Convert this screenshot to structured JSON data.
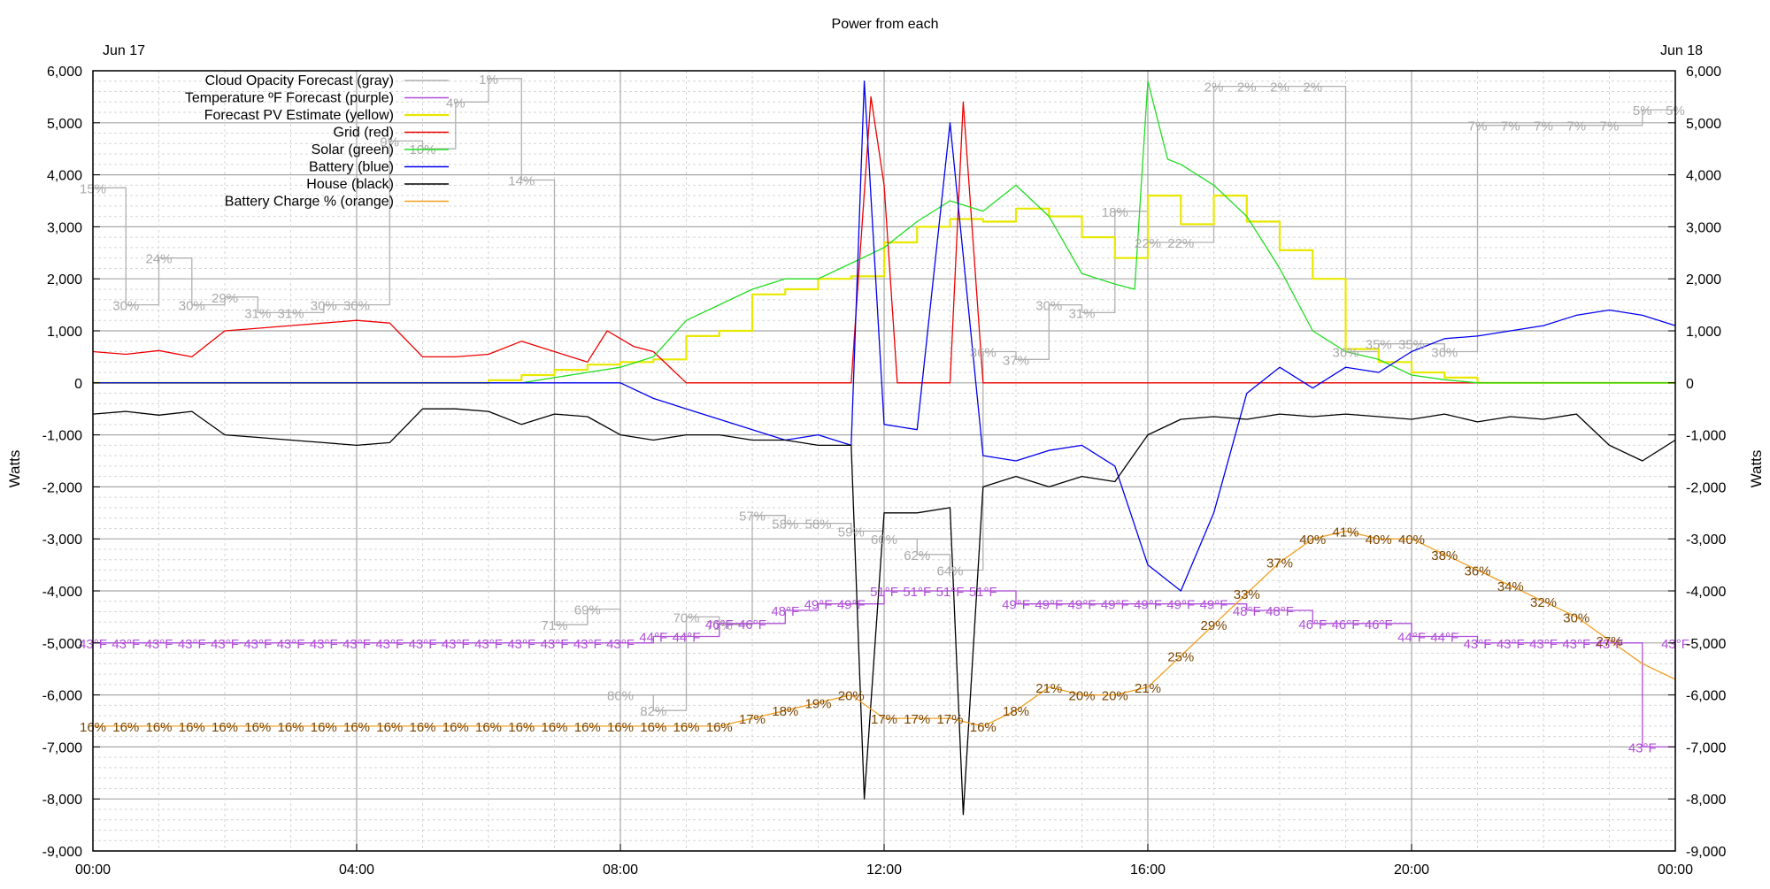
{
  "chart_data": {
    "type": "line",
    "title": "Power from each",
    "ylabel_left": "Watts",
    "ylabel_right": "Watts",
    "date_start": "Jun 17",
    "date_end": "Jun 18",
    "ylim": [
      -9000,
      6000
    ],
    "xlim_hours": [
      0,
      24
    ],
    "grid": true,
    "legend_placement": "top-left",
    "y_ticks": [
      "6,000",
      "5,000",
      "4,000",
      "3,000",
      "2,000",
      "1,000",
      "0",
      "-1,000",
      "-2,000",
      "-3,000",
      "-4,000",
      "-5,000",
      "-6,000",
      "-7,000",
      "-8,000",
      "-9,000"
    ],
    "x_ticks": [
      "00:00",
      "04:00",
      "08:00",
      "12:00",
      "16:00",
      "20:00",
      "00:00"
    ],
    "series": [
      {
        "name": "Cloud Opacity Forecast (gray)",
        "color": "#b0b0b0",
        "x": [
          0,
          0.5,
          1,
          1.5,
          2,
          2.5,
          3,
          3.5,
          4,
          4.5,
          5,
          5.5,
          6,
          6.5,
          7,
          7.5,
          8,
          8.5,
          9,
          9.5,
          10,
          10.5,
          11,
          11.5,
          12,
          12.5,
          13,
          13.5,
          14,
          14.5,
          15,
          15.5,
          16,
          16.5,
          17,
          17.5,
          18,
          18.5,
          19,
          19.5,
          20,
          20.5,
          21,
          21.5,
          22,
          22.5,
          23,
          23.5,
          24
        ],
        "y": [
          15,
          30,
          24,
          30,
          29,
          31,
          31,
          30,
          30,
          9,
          10,
          4,
          1,
          14,
          71,
          69,
          80,
          82,
          70,
          71,
          57,
          58,
          58,
          59,
          60,
          62,
          64,
          36,
          37,
          30,
          31,
          18,
          22,
          22,
          2,
          2,
          2,
          2,
          36,
          35,
          35,
          36,
          7,
          7,
          7,
          7,
          7,
          5,
          5
        ],
        "labels": [
          "15%",
          "30%",
          "24%",
          "30%",
          "29%",
          "31%",
          "31%",
          "30%",
          "30%",
          "9%",
          "10%",
          "4%",
          "1%",
          "14%",
          "71%",
          "69%",
          "80%",
          "82%",
          "70%",
          "71%",
          "57%",
          "58%",
          "58%",
          "59%",
          "60%",
          "62%",
          "64%",
          "36%",
          "37%",
          "30%",
          "31%",
          "18%",
          "22%",
          "22%",
          "2%",
          "2%",
          "2%",
          "2%",
          "36%",
          "35%",
          "35%",
          "36%",
          "7%",
          "7%",
          "7%",
          "7%",
          "7%",
          "5%",
          "5%"
        ]
      },
      {
        "name": "Temperature ºF Forecast (purple)",
        "color": "#b04fd8",
        "x": [
          0,
          0.5,
          1,
          1.5,
          2,
          2.5,
          3,
          3.5,
          4,
          4.5,
          5,
          5.5,
          6,
          6.5,
          7,
          7.5,
          8,
          8.5,
          9,
          9.5,
          10,
          10.5,
          11,
          11.5,
          12,
          12.5,
          13,
          13.5,
          14,
          14.5,
          15,
          15.5,
          16,
          16.5,
          17,
          17.5,
          18,
          18.5,
          19,
          19.5,
          20,
          20.5,
          21,
          21.5,
          22,
          22.5,
          23,
          23.5,
          24
        ],
        "y": [
          43,
          43,
          43,
          43,
          43,
          43,
          43,
          43,
          43,
          43,
          43,
          43,
          43,
          43,
          43,
          43,
          43,
          44,
          44,
          46,
          46,
          48,
          49,
          49,
          51,
          51,
          51,
          51,
          49,
          49,
          49,
          49,
          49,
          49,
          49,
          48,
          48,
          46,
          46,
          46,
          44,
          44,
          43,
          43,
          43,
          43,
          43,
          27,
          43
        ],
        "labels": [
          "43°F",
          "43°F",
          "43°F",
          "43°F",
          "43°F",
          "43°F",
          "43°F",
          "43°F",
          "43°F",
          "43°F",
          "43°F",
          "43°F",
          "43°F",
          "43°F",
          "43°F",
          "43°F",
          "43°F",
          "44°F",
          "44°F",
          "46°F",
          "46°F",
          "48°F",
          "49°F",
          "49°F",
          "51°F",
          "51°F",
          "51°F",
          "51°F",
          "49°F",
          "49°F",
          "49°F",
          "49°F",
          "49°F",
          "49°F",
          "49°F",
          "48°F",
          "48°F",
          "46°F",
          "46°F",
          "46°F",
          "44°F",
          "44°F",
          "43°F",
          "43°F",
          "43°F",
          "43°F",
          "43°F",
          "43°F",
          "43°F"
        ]
      },
      {
        "name": "Forecast PV Estimate (yellow)",
        "color": "#e8e800",
        "x": [
          0,
          6,
          6.5,
          7,
          7.5,
          8,
          8.5,
          9,
          9.5,
          10,
          10.5,
          11,
          11.5,
          12,
          12.5,
          13,
          13.5,
          14,
          14.5,
          15,
          15.5,
          16,
          16.5,
          17,
          17.5,
          18,
          18.5,
          19,
          19.5,
          20,
          20.5,
          21,
          24
        ],
        "y": [
          0,
          50,
          150,
          250,
          350,
          400,
          450,
          900,
          1000,
          1700,
          1800,
          2000,
          2050,
          2700,
          3000,
          3150,
          3100,
          3350,
          3200,
          2800,
          2400,
          3600,
          3050,
          3600,
          3100,
          2550,
          2000,
          650,
          400,
          200,
          100,
          0,
          0
        ]
      },
      {
        "name": "Grid (red)",
        "color": "#ee0000",
        "x": [
          0,
          0.5,
          1,
          1.5,
          2,
          2.5,
          3,
          3.5,
          4,
          4.5,
          5,
          5.5,
          6,
          6.5,
          7,
          7.5,
          7.8,
          8.2,
          8.5,
          9,
          11.5,
          11.8,
          12,
          12.2,
          12.5,
          13,
          13.2,
          13.5,
          14,
          16,
          20,
          24
        ],
        "y": [
          600,
          550,
          620,
          500,
          1000,
          1050,
          1100,
          1150,
          1200,
          1150,
          500,
          500,
          550,
          800,
          600,
          400,
          1000,
          700,
          600,
          0,
          0,
          5500,
          3800,
          0,
          0,
          0,
          5400,
          0,
          0,
          0,
          0,
          0
        ]
      },
      {
        "name": "Solar (green)",
        "color": "#22dd22",
        "x": [
          0,
          6.5,
          7,
          7.5,
          8,
          8.5,
          9,
          9.5,
          10,
          10.5,
          11,
          11.5,
          12,
          12.5,
          13,
          13.5,
          14,
          14.5,
          15,
          15.5,
          15.8,
          16,
          16.3,
          16.5,
          17,
          17.5,
          18,
          18.5,
          19,
          19.5,
          20,
          20.5,
          21,
          24
        ],
        "y": [
          0,
          0,
          100,
          200,
          300,
          500,
          1200,
          1500,
          1800,
          2000,
          2000,
          2300,
          2600,
          3100,
          3500,
          3300,
          3800,
          3200,
          2100,
          1900,
          1800,
          5800,
          4300,
          4200,
          3800,
          3200,
          2200,
          1000,
          600,
          450,
          150,
          60,
          0,
          0
        ]
      },
      {
        "name": "Battery (blue)",
        "color": "#0000ee",
        "x": [
          0,
          8,
          8.5,
          9,
          9.5,
          10,
          10.5,
          11,
          11.5,
          11.7,
          12,
          12.5,
          13,
          13.5,
          14,
          14.5,
          15,
          15.5,
          16,
          16.5,
          17,
          17.5,
          18,
          18.5,
          19,
          19.5,
          20,
          20.5,
          21,
          21.5,
          22,
          22.5,
          23,
          23.5,
          24
        ],
        "y": [
          0,
          0,
          -300,
          -500,
          -700,
          -900,
          -1100,
          -1000,
          -1200,
          5800,
          -800,
          -900,
          5000,
          -1400,
          -1500,
          -1300,
          -1200,
          -1600,
          -3500,
          -4000,
          -2500,
          -200,
          300,
          -100,
          300,
          200,
          600,
          850,
          900,
          1000,
          1100,
          1300,
          1400,
          1300,
          1100
        ]
      },
      {
        "name": "House (black)",
        "color": "#000000",
        "x": [
          0,
          0.5,
          1,
          1.5,
          2,
          2.5,
          3,
          3.5,
          4,
          4.5,
          5,
          5.5,
          6,
          6.5,
          7,
          7.5,
          8,
          8.5,
          9,
          9.5,
          10,
          10.5,
          11,
          11.5,
          11.7,
          12,
          12.5,
          13,
          13.2,
          13.5,
          14,
          14.5,
          15,
          15.5,
          16,
          16.5,
          17,
          17.5,
          18,
          18.5,
          19,
          19.5,
          20,
          20.5,
          21,
          21.5,
          22,
          22.5,
          23,
          23.5,
          24
        ],
        "y": [
          -600,
          -550,
          -620,
          -550,
          -1000,
          -1050,
          -1100,
          -1150,
          -1200,
          -1150,
          -500,
          -500,
          -550,
          -800,
          -600,
          -650,
          -1000,
          -1100,
          -1000,
          -1000,
          -1100,
          -1100,
          -1200,
          -1200,
          -8000,
          -2500,
          -2500,
          -2400,
          -8300,
          -2000,
          -1800,
          -2000,
          -1800,
          -1900,
          -1000,
          -700,
          -650,
          -700,
          -600,
          -650,
          -600,
          -650,
          -700,
          -600,
          -750,
          -650,
          -700,
          -600,
          -1200,
          -1500,
          -1100
        ]
      },
      {
        "name": "Battery Charge % (orange)",
        "color": "#f0a020",
        "x": [
          0,
          0.5,
          1,
          1.5,
          2,
          2.5,
          3,
          3.5,
          4,
          4.5,
          5,
          5.5,
          6,
          6.5,
          7,
          7.5,
          8,
          8.5,
          9,
          9.5,
          10,
          10.5,
          11,
          11.5,
          12,
          12.5,
          13,
          13.5,
          14,
          14.5,
          15,
          15.5,
          16,
          16.5,
          17,
          17.5,
          18,
          18.5,
          19,
          19.5,
          20,
          20.5,
          21,
          21.5,
          22,
          22.5,
          23,
          23.5,
          24
        ],
        "y": [
          16,
          16,
          16,
          16,
          16,
          16,
          16,
          16,
          16,
          16,
          16,
          16,
          16,
          16,
          16,
          16,
          16,
          16,
          16,
          16,
          17,
          18,
          19,
          20,
          17,
          17,
          17,
          16,
          18,
          21,
          20,
          20,
          21,
          25,
          29,
          33,
          37,
          40,
          41,
          40,
          40,
          38,
          36,
          34,
          32,
          30,
          27,
          24,
          22
        ],
        "labels": [
          "16%",
          "16%",
          "16%",
          "16%",
          "16%",
          "16%",
          "16%",
          "16%",
          "16%",
          "16%",
          "16%",
          "16%",
          "16%",
          "16%",
          "16%",
          "16%",
          "16%",
          "16%",
          "16%",
          "16%",
          "17%",
          "18%",
          "19%",
          "20%",
          "17%",
          "17%",
          "17%",
          "16%",
          "18%",
          "21%",
          "20%",
          "20%",
          "21%",
          "25%",
          "29%",
          "33%",
          "37%",
          "40%",
          "41%",
          "40%",
          "40%",
          "38%",
          "36%",
          "34%",
          "32%",
          "30%",
          "27%",
          "",
          ""
        ]
      }
    ]
  }
}
